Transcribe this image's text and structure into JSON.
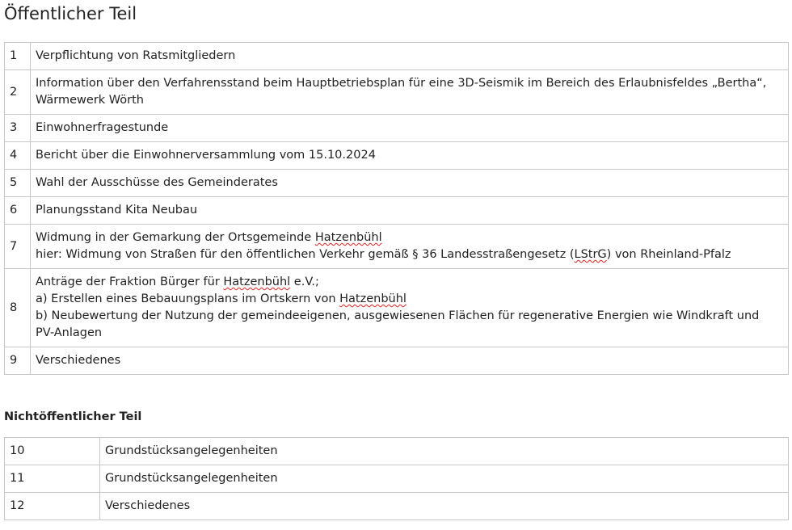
{
  "public_section": {
    "title": "Öffentlicher Teil",
    "items": [
      {
        "num": "1",
        "lines": [
          [
            "Verpflichtung von Ratsmitgliedern"
          ]
        ]
      },
      {
        "num": "2",
        "lines": [
          [
            "Information über den Verfahrensstand beim Hauptbetriebsplan für eine 3D-Seismik im Bereich des Erlaubnisfeldes „Bertha“,"
          ],
          [
            "Wärmewerk Wörth"
          ]
        ]
      },
      {
        "num": "3",
        "lines": [
          [
            "Einwohnerfragestunde"
          ]
        ]
      },
      {
        "num": "4",
        "lines": [
          [
            "Bericht über die Einwohnerversammlung vom 15.10.2024"
          ]
        ]
      },
      {
        "num": "5",
        "lines": [
          [
            "Wahl der Ausschüsse des Gemeinderates"
          ]
        ]
      },
      {
        "num": "6",
        "lines": [
          [
            "Planungsstand Kita Neubau"
          ]
        ]
      },
      {
        "num": "7",
        "lines": [
          [
            "Widmung in der Gemarkung der Ortsgemeinde ",
            {
              "spell": "Hatzenbühl"
            }
          ],
          [
            "hier: Widmung von Straßen für den öffentlichen Verkehr gemäß § 36 Landesstraßengesetz (",
            {
              "spell": "LStrG"
            },
            ") von Rheinland-Pfalz"
          ]
        ]
      },
      {
        "num": "8",
        "lines": [
          [
            "Anträge der Fraktion Bürger für ",
            {
              "spell": "Hatzenbühl"
            },
            " e.V.;"
          ],
          [
            "a) Erstellen eines Bebauungsplans im Ortskern von ",
            {
              "spell": "Hatzenbühl"
            }
          ],
          [
            "b) Neubewertung der Nutzung der gemeindeeigenen, ausgewiesenen Flächen für regenerative Energien wie Windkraft und"
          ],
          [
            "PV-Anlagen"
          ]
        ]
      },
      {
        "num": "9",
        "lines": [
          [
            "Verschiedenes"
          ]
        ]
      }
    ]
  },
  "private_section": {
    "title": "Nichtöffentlicher Teil",
    "items": [
      {
        "num": "10",
        "lines": [
          [
            "Grundstücksangelegenheiten"
          ]
        ]
      },
      {
        "num": "11",
        "lines": [
          [
            "Grundstücksangelegenheiten"
          ]
        ]
      },
      {
        "num": "12",
        "lines": [
          [
            "Verschiedenes"
          ]
        ]
      }
    ]
  },
  "colors": {
    "text": "#222222",
    "border": "#c6c6c6",
    "spellcheck_underline": "#e02020"
  }
}
